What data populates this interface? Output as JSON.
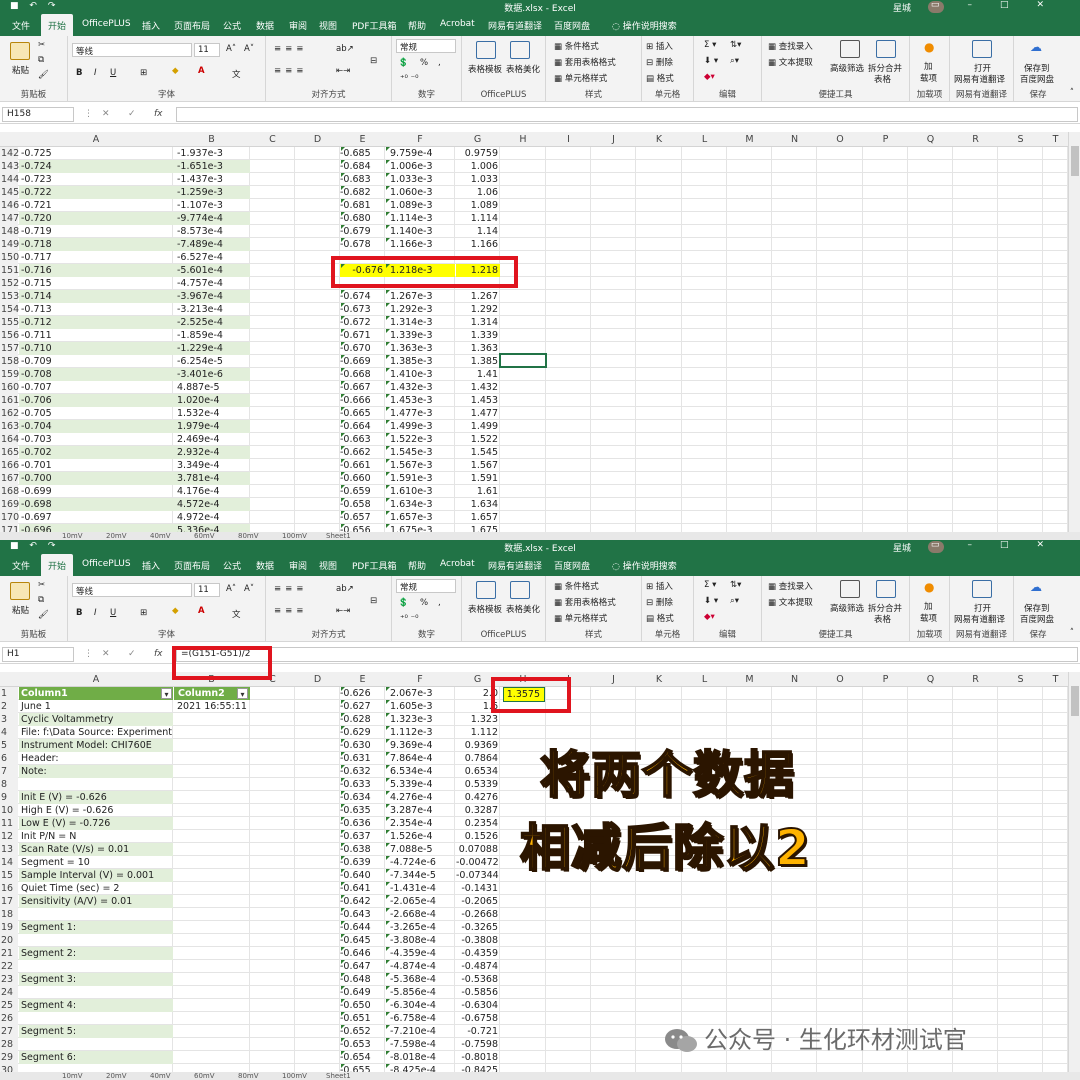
{
  "window": {
    "title": "数据.xlsx - Excel",
    "user": "星城",
    "quick_access": "↶ ↷ ▾"
  },
  "tabs": [
    "文件",
    "开始",
    "OfficePLUS",
    "插入",
    "页面布局",
    "公式",
    "数据",
    "审阅",
    "视图",
    "PDF工具箱",
    "帮助",
    "Acrobat",
    "网易有道翻译",
    "百度网盘"
  ],
  "active_tab": "开始",
  "tell_me": "操作说明搜索",
  "ribbon": {
    "paste": "粘贴",
    "clipboard": "剪贴板",
    "font_name": "等线",
    "font_size": "11",
    "font_group": "字体",
    "align_group": "对齐方式",
    "number_format": "常规",
    "number_group": "数字",
    "table_template": "表格模板",
    "table_beautify": "表格美化",
    "officeplus_group": "OfficePLUS",
    "cond_format": "条件格式",
    "table_format": "套用表格格式",
    "cell_style": "单元格样式",
    "style_group": "样式",
    "insert": "插入",
    "delete": "删除",
    "format": "格式",
    "cells_group": "单元格",
    "edit_group": "编辑",
    "find_entry": "查找录入",
    "text_extract": "文本提取",
    "adv_filter": "高级筛选",
    "split_merge_1": "拆分合并",
    "split_merge_2": "表格",
    "tools_group": "便捷工具",
    "addin_1": "加",
    "addin_2": "载项",
    "addin_group": "加载项",
    "youdao_1": "打开",
    "youdao_2": "网易有道翻译",
    "youdao_group": "网易有道翻译",
    "baidu_1": "保存到",
    "baidu_2": "百度网盘",
    "baidu_group": "保存",
    "bold": "B",
    "italic": "I",
    "underline": "U",
    "percent": "%",
    "comma": ","
  },
  "columns": [
    "A",
    "B",
    "C",
    "D",
    "E",
    "F",
    "G",
    "H",
    "I",
    "J",
    "K",
    "L",
    "M",
    "N",
    "O",
    "P",
    "Q",
    "R",
    "S",
    "T"
  ],
  "top": {
    "name_box": "H158",
    "formula": "",
    "rows": [
      {
        "n": "142",
        "a": "-0.725",
        "b": "-1.937e-3",
        "e": "-0.685",
        "f": "9.759e-4",
        "g": "0.9759"
      },
      {
        "n": "143",
        "a": "-0.724",
        "b": "-1.651e-3",
        "e": "-0.684",
        "f": "1.006e-3",
        "g": "1.006"
      },
      {
        "n": "144",
        "a": "-0.723",
        "b": "-1.437e-3",
        "e": "-0.683",
        "f": "1.033e-3",
        "g": "1.033"
      },
      {
        "n": "145",
        "a": "-0.722",
        "b": "-1.259e-3",
        "e": "-0.682",
        "f": "1.060e-3",
        "g": "1.06"
      },
      {
        "n": "146",
        "a": "-0.721",
        "b": "-1.107e-3",
        "e": "-0.681",
        "f": "1.089e-3",
        "g": "1.089"
      },
      {
        "n": "147",
        "a": "-0.720",
        "b": "-9.774e-4",
        "e": "-0.680",
        "f": "1.114e-3",
        "g": "1.114"
      },
      {
        "n": "148",
        "a": "-0.719",
        "b": "-8.573e-4",
        "e": "-0.679",
        "f": "1.140e-3",
        "g": "1.14"
      },
      {
        "n": "149",
        "a": "-0.718",
        "b": "-7.489e-4",
        "e": "-0.678",
        "f": "1.166e-3",
        "g": "1.166"
      },
      {
        "n": "150",
        "a": "-0.717",
        "b": "-6.527e-4",
        "e": "",
        "f": "",
        "g": ""
      },
      {
        "n": "151",
        "a": "-0.716",
        "b": "-5.601e-4",
        "e": "-0.676",
        "f": "1.218e-3",
        "g": "1.218"
      },
      {
        "n": "152",
        "a": "-0.715",
        "b": "-4.757e-4",
        "e": "",
        "f": "",
        "g": ""
      },
      {
        "n": "153",
        "a": "-0.714",
        "b": "-3.967e-4",
        "e": "-0.674",
        "f": "1.267e-3",
        "g": "1.267"
      },
      {
        "n": "154",
        "a": "-0.713",
        "b": "-3.213e-4",
        "e": "-0.673",
        "f": "1.292e-3",
        "g": "1.292"
      },
      {
        "n": "155",
        "a": "-0.712",
        "b": "-2.525e-4",
        "e": "-0.672",
        "f": "1.314e-3",
        "g": "1.314"
      },
      {
        "n": "156",
        "a": "-0.711",
        "b": "-1.859e-4",
        "e": "-0.671",
        "f": "1.339e-3",
        "g": "1.339"
      },
      {
        "n": "157",
        "a": "-0.710",
        "b": "-1.229e-4",
        "e": "-0.670",
        "f": "1.363e-3",
        "g": "1.363"
      },
      {
        "n": "158",
        "a": "-0.709",
        "b": "-6.254e-5",
        "e": "-0.669",
        "f": "1.385e-3",
        "g": "1.385"
      },
      {
        "n": "159",
        "a": "-0.708",
        "b": "-3.401e-6",
        "e": "-0.668",
        "f": "1.410e-3",
        "g": "1.41"
      },
      {
        "n": "160",
        "a": "-0.707",
        "b": "4.887e-5",
        "e": "-0.667",
        "f": "1.432e-3",
        "g": "1.432"
      },
      {
        "n": "161",
        "a": "-0.706",
        "b": "1.020e-4",
        "e": "-0.666",
        "f": "1.453e-3",
        "g": "1.453"
      },
      {
        "n": "162",
        "a": "-0.705",
        "b": "1.532e-4",
        "e": "-0.665",
        "f": "1.477e-3",
        "g": "1.477"
      },
      {
        "n": "163",
        "a": "-0.704",
        "b": "1.979e-4",
        "e": "-0.664",
        "f": "1.499e-3",
        "g": "1.499"
      },
      {
        "n": "164",
        "a": "-0.703",
        "b": "2.469e-4",
        "e": "-0.663",
        "f": "1.522e-3",
        "g": "1.522"
      },
      {
        "n": "165",
        "a": "-0.702",
        "b": "2.932e-4",
        "e": "-0.662",
        "f": "1.545e-3",
        "g": "1.545"
      },
      {
        "n": "166",
        "a": "-0.701",
        "b": "3.349e-4",
        "e": "-0.661",
        "f": "1.567e-3",
        "g": "1.567"
      },
      {
        "n": "167",
        "a": "-0.700",
        "b": "3.781e-4",
        "e": "-0.660",
        "f": "1.591e-3",
        "g": "1.591"
      },
      {
        "n": "168",
        "a": "-0.699",
        "b": "4.176e-4",
        "e": "-0.659",
        "f": "1.610e-3",
        "g": "1.61"
      },
      {
        "n": "169",
        "a": "-0.698",
        "b": "4.572e-4",
        "e": "-0.658",
        "f": "1.634e-3",
        "g": "1.634"
      },
      {
        "n": "170",
        "a": "-0.697",
        "b": "4.972e-4",
        "e": "-0.657",
        "f": "1.657e-3",
        "g": "1.657"
      },
      {
        "n": "171",
        "a": "-0.696",
        "b": "5.336e-4",
        "e": "-0.656",
        "f": "1.675e-3",
        "g": "1.675"
      }
    ],
    "sheet_tabs": [
      "10mV",
      "20mV",
      "40mV",
      "60mV",
      "80mV",
      "100mV",
      "Sheet1"
    ]
  },
  "bottom": {
    "name_box": "H1",
    "formula": "=(G151-G51)/2",
    "h1_value": "1.3575",
    "rows": [
      {
        "n": "1",
        "a": "Column1",
        "b": "Column2",
        "e": "-0.626",
        "f": "2.067e-3",
        "g": "2.0"
      },
      {
        "n": "2",
        "a": "June 1",
        "b": "2021   16:55:11",
        "e": "-0.627",
        "f": "1.605e-3",
        "g": "1.6"
      },
      {
        "n": "3",
        "a": "Cyclic Voltammetry",
        "b": "",
        "e": "-0.628",
        "f": "1.323e-3",
        "g": "1.323"
      },
      {
        "n": "4",
        "a": "File: f:\\Data Source:  Experiment",
        "b": "",
        "e": "-0.629",
        "f": "1.112e-3",
        "g": "1.112"
      },
      {
        "n": "5",
        "a": "Instrument Model:  CHI760E",
        "b": "",
        "e": "-0.630",
        "f": "9.369e-4",
        "g": "0.9369"
      },
      {
        "n": "6",
        "a": "Header:",
        "b": "",
        "e": "-0.631",
        "f": "7.864e-4",
        "g": "0.7864"
      },
      {
        "n": "7",
        "a": "Note:",
        "b": "",
        "e": "-0.632",
        "f": "6.534e-4",
        "g": "0.6534"
      },
      {
        "n": "8",
        "a": "",
        "b": "",
        "e": "-0.633",
        "f": "5.339e-4",
        "g": "0.5339"
      },
      {
        "n": "9",
        "a": "Init E (V) = -0.626",
        "b": "",
        "e": "-0.634",
        "f": "4.276e-4",
        "g": "0.4276"
      },
      {
        "n": "10",
        "a": "High E (V) = -0.626",
        "b": "",
        "e": "-0.635",
        "f": "3.287e-4",
        "g": "0.3287"
      },
      {
        "n": "11",
        "a": "Low E (V) = -0.726",
        "b": "",
        "e": "-0.636",
        "f": "2.354e-4",
        "g": "0.2354"
      },
      {
        "n": "12",
        "a": "Init P/N = N",
        "b": "",
        "e": "-0.637",
        "f": "1.526e-4",
        "g": "0.1526"
      },
      {
        "n": "13",
        "a": "Scan Rate (V/s) = 0.01",
        "b": "",
        "e": "-0.638",
        "f": "7.088e-5",
        "g": "0.07088"
      },
      {
        "n": "14",
        "a": "Segment = 10",
        "b": "",
        "e": "-0.639",
        "f": "-4.724e-6",
        "g": "-0.00472"
      },
      {
        "n": "15",
        "a": "Sample Interval (V) = 0.001",
        "b": "",
        "e": "-0.640",
        "f": "-7.344e-5",
        "g": "-0.07344"
      },
      {
        "n": "16",
        "a": "Quiet Time (sec) = 2",
        "b": "",
        "e": "-0.641",
        "f": "-1.431e-4",
        "g": "-0.1431"
      },
      {
        "n": "17",
        "a": "Sensitivity (A/V) = 0.01",
        "b": "",
        "e": "-0.642",
        "f": "-2.065e-4",
        "g": "-0.2065"
      },
      {
        "n": "18",
        "a": "",
        "b": "",
        "e": "-0.643",
        "f": "-2.668e-4",
        "g": "-0.2668"
      },
      {
        "n": "19",
        "a": "Segment 1:",
        "b": "",
        "e": "-0.644",
        "f": "-3.265e-4",
        "g": "-0.3265"
      },
      {
        "n": "20",
        "a": "",
        "b": "",
        "e": "-0.645",
        "f": "-3.808e-4",
        "g": "-0.3808"
      },
      {
        "n": "21",
        "a": "Segment 2:",
        "b": "",
        "e": "-0.646",
        "f": "-4.359e-4",
        "g": "-0.4359"
      },
      {
        "n": "22",
        "a": "",
        "b": "",
        "e": "-0.647",
        "f": "-4.874e-4",
        "g": "-0.4874"
      },
      {
        "n": "23",
        "a": "Segment 3:",
        "b": "",
        "e": "-0.648",
        "f": "-5.368e-4",
        "g": "-0.5368"
      },
      {
        "n": "24",
        "a": "",
        "b": "",
        "e": "-0.649",
        "f": "-5.856e-4",
        "g": "-0.5856"
      },
      {
        "n": "25",
        "a": "Segment 4:",
        "b": "",
        "e": "-0.650",
        "f": "-6.304e-4",
        "g": "-0.6304"
      },
      {
        "n": "26",
        "a": "",
        "b": "",
        "e": "-0.651",
        "f": "-6.758e-4",
        "g": "-0.6758"
      },
      {
        "n": "27",
        "a": "Segment 5:",
        "b": "",
        "e": "-0.652",
        "f": "-7.210e-4",
        "g": "-0.721"
      },
      {
        "n": "28",
        "a": "",
        "b": "",
        "e": "-0.653",
        "f": "-7.598e-4",
        "g": "-0.7598"
      },
      {
        "n": "29",
        "a": "Segment 6:",
        "b": "",
        "e": "-0.654",
        "f": "-8.018e-4",
        "g": "-0.8018"
      },
      {
        "n": "30",
        "a": "",
        "b": "",
        "e": "-0.655",
        "f": "-8.425e-4",
        "g": "-0.8425"
      }
    ],
    "sheet_tabs": [
      "10mV",
      "20mV",
      "40mV",
      "60mV",
      "80mV",
      "100mV",
      "Sheet1"
    ]
  },
  "overlay": {
    "line1": "将两个数据",
    "line2": "相减后除以2"
  },
  "watermark": "公众号 · 生化环材测试官",
  "colors": {
    "excel_green": "#217346",
    "highlight": "#ffff00",
    "annotation_red": "#e0141e",
    "overlay_text": "#ffb300",
    "band_green": "#e2efda",
    "header_green": "#70ad47"
  }
}
